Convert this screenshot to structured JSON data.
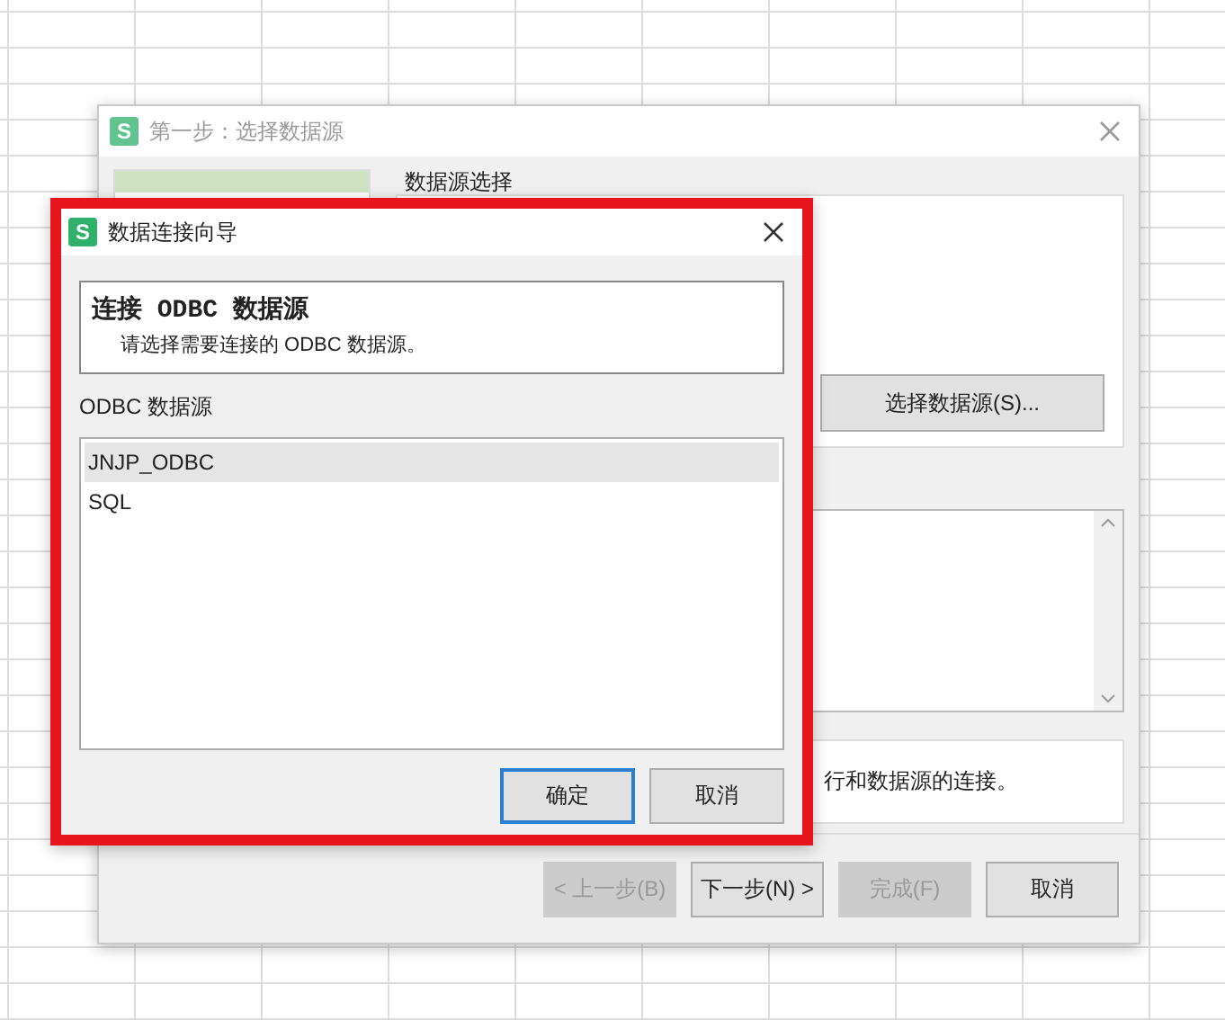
{
  "back_dialog": {
    "icon_letter": "S",
    "title": "第一步：选择数据源",
    "section_label": "数据源选择",
    "select_button": "选择数据源(S)...",
    "info_text": "行和数据源的连接。",
    "buttons": [
      {
        "label": "< 上一步(B)",
        "disabled": true
      },
      {
        "label": "下一步(N) >",
        "disabled": false
      },
      {
        "label": "完成(F)",
        "disabled": true
      },
      {
        "label": "取消",
        "disabled": false
      }
    ]
  },
  "front_dialog": {
    "icon_letter": "S",
    "title": "数据连接向导",
    "header_title": "连接 ODBC 数据源",
    "header_subtitle": "请选择需要连接的 ODBC 数据源。",
    "list_label": "ODBC 数据源",
    "sources": [
      {
        "name": "JNJP_ODBC",
        "selected": true
      },
      {
        "name": "SQL",
        "selected": false
      }
    ],
    "buttons": [
      {
        "label": "确定",
        "default": true
      },
      {
        "label": "取消",
        "default": false
      }
    ]
  }
}
